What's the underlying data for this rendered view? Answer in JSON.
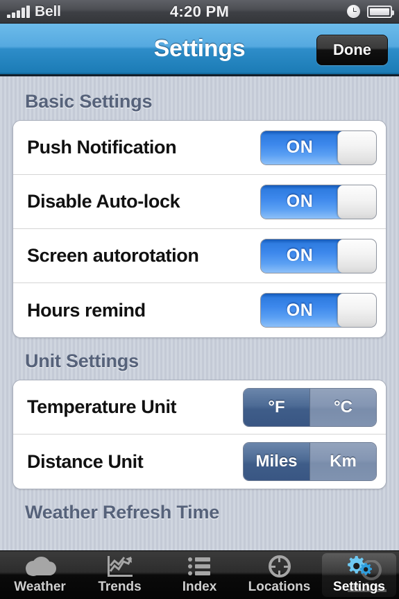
{
  "status_bar": {
    "carrier": "Bell",
    "time": "4:20 PM",
    "signal_bars": 5,
    "alarm_icon": "alarm-clock-icon",
    "battery_icon": "battery-full-icon"
  },
  "nav_bar": {
    "title": "Settings",
    "done_label": "Done",
    "gradient_top": "#6cbbea",
    "gradient_bottom": "#1c7cb6"
  },
  "sections": [
    {
      "header": "Basic Settings",
      "rows": [
        {
          "label": "Push Notification",
          "control": "switch",
          "value": "ON"
        },
        {
          "label": "Disable Auto-lock",
          "control": "switch",
          "value": "ON"
        },
        {
          "label": "Screen autorotation",
          "control": "switch",
          "value": "ON"
        },
        {
          "label": "Hours remind",
          "control": "switch",
          "value": "ON"
        }
      ]
    },
    {
      "header": "Unit Settings",
      "rows": [
        {
          "label": "Temperature Unit",
          "control": "segmented",
          "options": [
            "°F",
            "°C"
          ],
          "selected": "°F"
        },
        {
          "label": "Distance Unit",
          "control": "segmented",
          "options": [
            "Miles",
            "Km"
          ],
          "selected": "Miles"
        }
      ]
    },
    {
      "header": "Weather Refresh Time",
      "clipped": true,
      "rows": []
    }
  ],
  "colors": {
    "switch_on_blue": "#3d88ec",
    "segment_selected": "#3f5d89",
    "segment_unselected": "#7a8dab",
    "section_header_text": "#56627a",
    "row_text": "#111111",
    "page_background": "#cfd5df"
  },
  "tab_bar": {
    "active": "Settings",
    "tabs": [
      {
        "label": "Weather",
        "icon": "cloud-icon"
      },
      {
        "label": "Trends",
        "icon": "line-chart-icon"
      },
      {
        "label": "Index",
        "icon": "list-icon"
      },
      {
        "label": "Locations",
        "icon": "crosshair-icon"
      },
      {
        "label": "Settings",
        "icon": "gears-icon"
      }
    ]
  }
}
